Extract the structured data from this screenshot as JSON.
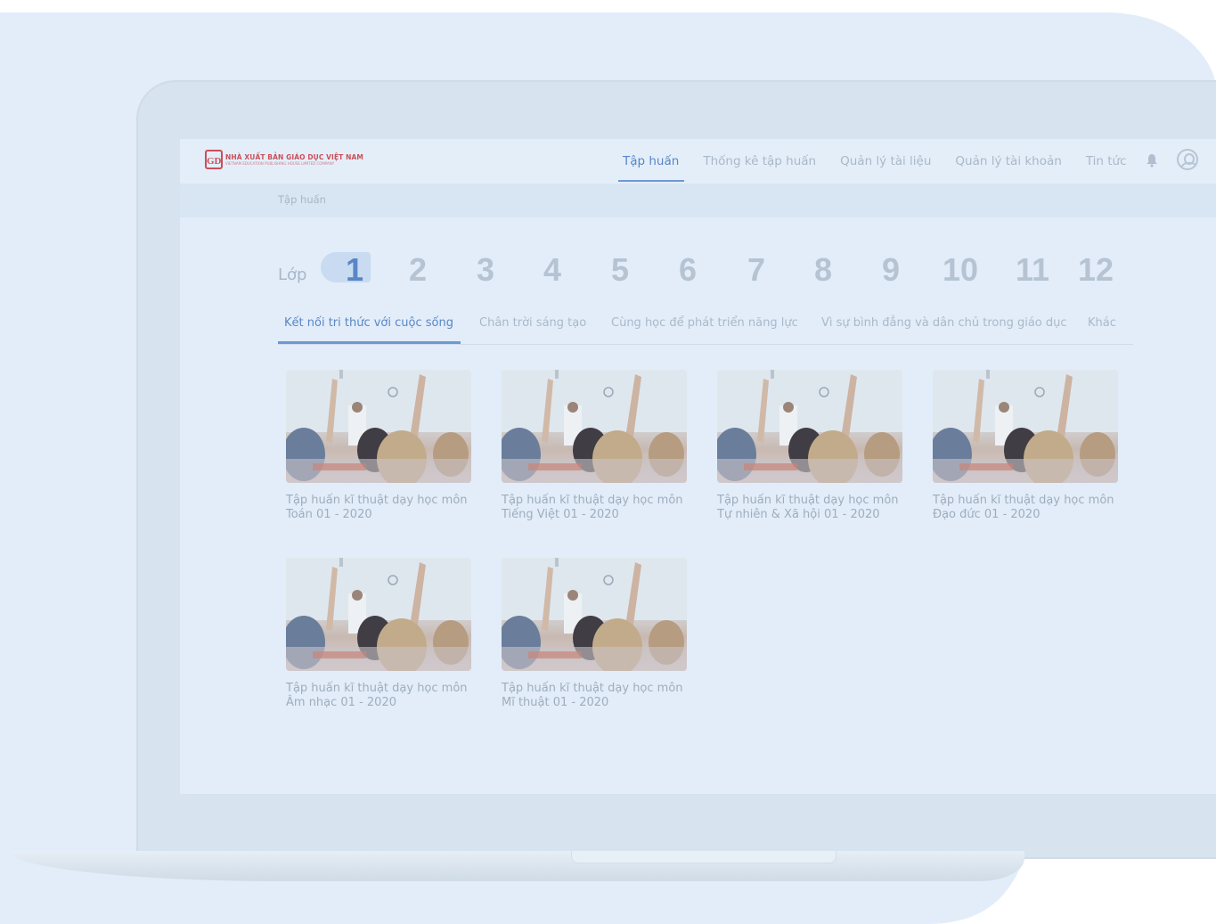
{
  "app": {
    "logo_line1": "NHÀ XUẤT BẢN GIÁO DỤC VIỆT NAM",
    "logo_line2": "VIETNAM EDUCATION PUBLISHING HOUSE LIMITED COMPANY",
    "logo_mark": "GD"
  },
  "nav": {
    "items": [
      {
        "label": "Tập huấn",
        "active": true
      },
      {
        "label": "Thống kê tập huấn",
        "active": false
      },
      {
        "label": "Quản lý tài liệu",
        "active": false
      },
      {
        "label": "Quản lý tài khoản",
        "active": false
      },
      {
        "label": "Tin tức",
        "active": false
      }
    ],
    "bell_icon": "bell-icon",
    "avatar_icon": "user-avatar-icon"
  },
  "breadcrumb": "Tập huấn",
  "grade_selector": {
    "label": "Lớp",
    "grades": [
      "1",
      "2",
      "3",
      "4",
      "5",
      "6",
      "7",
      "8",
      "9",
      "10",
      "11",
      "12"
    ],
    "selected": "1"
  },
  "tabs": [
    {
      "label": "Kết nối tri thức với cuộc sống",
      "active": true
    },
    {
      "label": "Chân trời sáng tạo",
      "active": false
    },
    {
      "label": "Cùng học để phát triển năng lực",
      "active": false
    },
    {
      "label": "Vì sự bình đẳng và dân chủ trong giáo dục",
      "active": false
    },
    {
      "label": "Khác",
      "active": false
    }
  ],
  "courses": [
    {
      "line1": "Tập huấn kĩ thuật dạy học môn",
      "line2": "Toán 01 - 2020"
    },
    {
      "line1": "Tập huấn kĩ thuật dạy học môn",
      "line2": "Tiếng Việt 01 - 2020"
    },
    {
      "line1": "Tập huấn kĩ thuật dạy học môn",
      "line2": "Tự nhiên & Xã hội 01 - 2020"
    },
    {
      "line1": "Tập huấn kĩ thuật dạy học môn",
      "line2": "Đạo đức 01 - 2020"
    },
    {
      "line1": "Tập huấn kĩ thuật dạy học môn",
      "line2": "Âm nhạc 01 - 2020"
    },
    {
      "line1": "Tập huấn kĩ thuật dạy học môn",
      "line2": "Mĩ thuật 01 - 2020"
    }
  ]
}
